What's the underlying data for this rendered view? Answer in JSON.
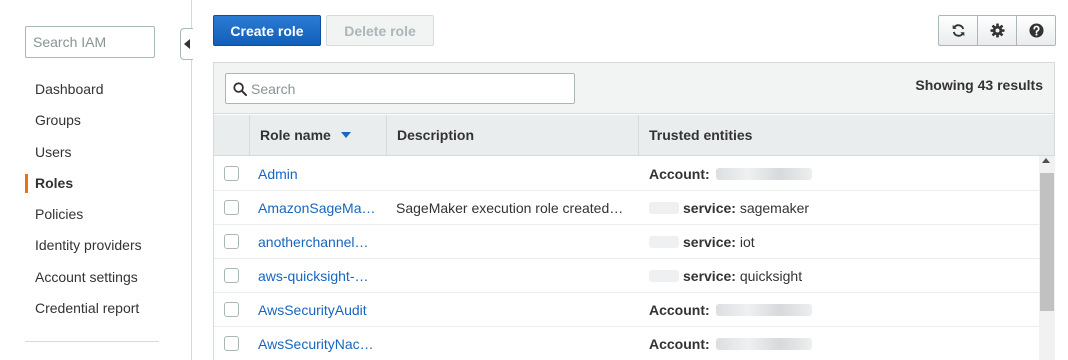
{
  "sidebar": {
    "search_placeholder": "Search IAM",
    "items": [
      {
        "label": "Dashboard",
        "active": false
      },
      {
        "label": "Groups",
        "active": false
      },
      {
        "label": "Users",
        "active": false
      },
      {
        "label": "Roles",
        "active": true
      },
      {
        "label": "Policies",
        "active": false
      },
      {
        "label": "Identity providers",
        "active": false
      },
      {
        "label": "Account settings",
        "active": false
      },
      {
        "label": "Credential report",
        "active": false
      }
    ]
  },
  "toolbar": {
    "create_label": "Create role",
    "delete_label": "Delete role",
    "icons": [
      "refresh-icon",
      "gear-icon",
      "help-icon"
    ]
  },
  "table": {
    "search_placeholder": "Search",
    "result_count": "Showing 43 results",
    "columns": [
      "Role name",
      "Description",
      "Trusted entities"
    ],
    "sort_column": "Role name",
    "rows": [
      {
        "name": "Admin",
        "description": "",
        "trust_label": "Account:",
        "trust_value": ""
      },
      {
        "name": "AmazonSageMa…",
        "description": "SageMaker execution role created…",
        "trust_label": "service:",
        "trust_value": "sagemaker"
      },
      {
        "name": "anotherchannel…",
        "description": "",
        "trust_label": "service:",
        "trust_value": "iot"
      },
      {
        "name": "aws-quicksight-…",
        "description": "",
        "trust_label": "service:",
        "trust_value": "quicksight"
      },
      {
        "name": "AwsSecurityAudit",
        "description": "",
        "trust_label": "Account:",
        "trust_value": ""
      },
      {
        "name": "AwsSecurityNac…",
        "description": "",
        "trust_label": "Account:",
        "trust_value": ""
      }
    ]
  },
  "colors": {
    "primary": "#1766c0",
    "active_indicator": "#ec7211",
    "link": "#1766c0"
  }
}
